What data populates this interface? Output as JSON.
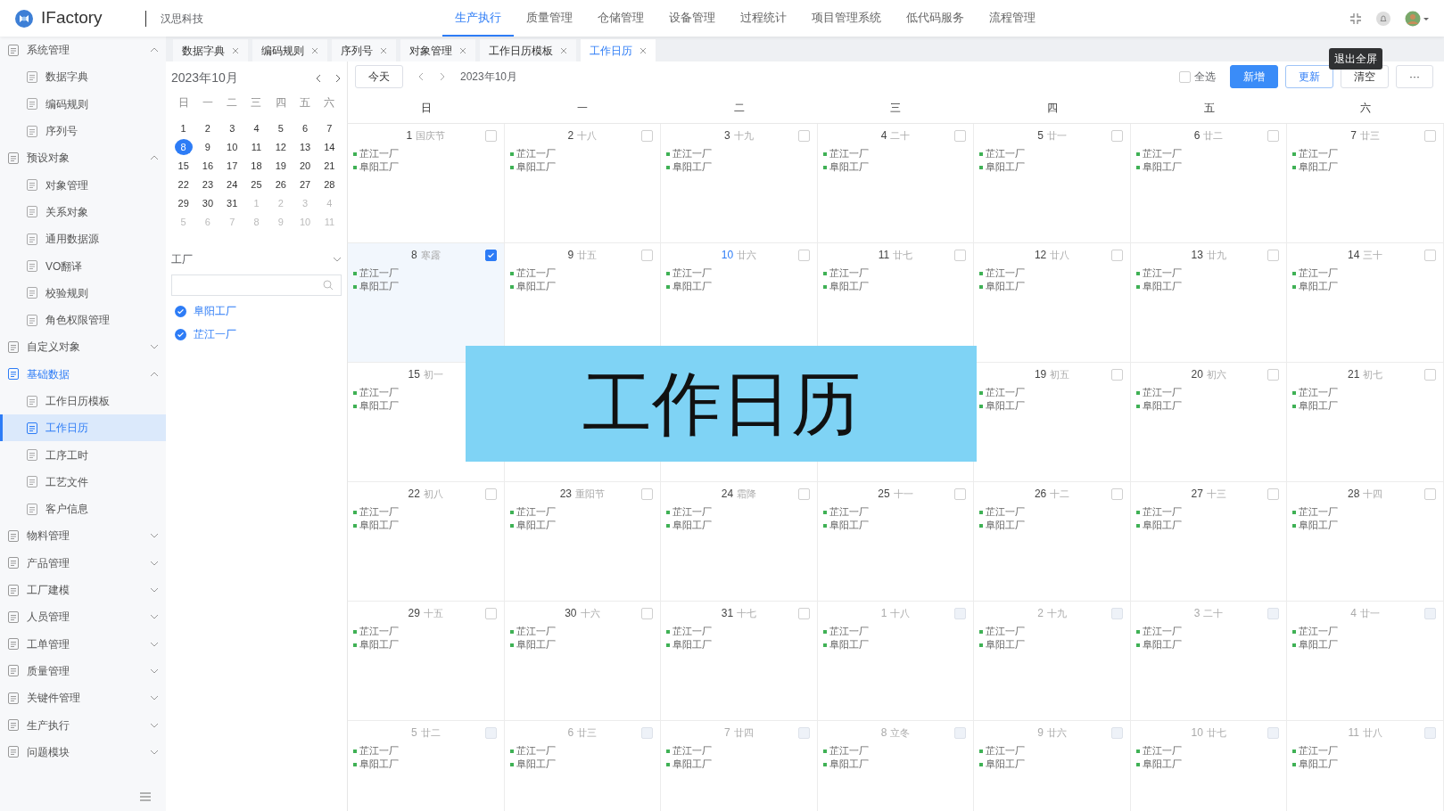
{
  "app": {
    "name": "IFactory",
    "company": "汉思科技"
  },
  "top_menu": [
    {
      "label": "生产执行",
      "selected": true
    },
    {
      "label": "质量管理",
      "selected": false
    },
    {
      "label": "仓储管理",
      "selected": false
    },
    {
      "label": "设备管理",
      "selected": false
    },
    {
      "label": "过程统计",
      "selected": false
    },
    {
      "label": "项目管理系统",
      "selected": false
    },
    {
      "label": "低代码服务",
      "selected": false
    },
    {
      "label": "流程管理",
      "selected": false
    }
  ],
  "tooltip": "退出全屏",
  "sidebar": [
    {
      "label": "系统管理",
      "selected": false,
      "expanded": true,
      "children": [
        {
          "label": "数据字典",
          "selected": false
        },
        {
          "label": "编码规则",
          "selected": false
        },
        {
          "label": "序列号",
          "selected": false
        }
      ]
    },
    {
      "label": "预设对象",
      "selected": false,
      "expanded": true,
      "children": [
        {
          "label": "对象管理",
          "selected": false
        },
        {
          "label": "关系对象",
          "selected": false
        },
        {
          "label": "通用数据源",
          "selected": false
        },
        {
          "label": "VO翻译",
          "selected": false
        },
        {
          "label": "校验规则",
          "selected": false
        },
        {
          "label": "角色权限管理",
          "selected": false
        }
      ]
    },
    {
      "label": "自定义对象",
      "selected": false,
      "expanded": false
    },
    {
      "label": "基础数据",
      "selected": true,
      "expanded": true,
      "children": [
        {
          "label": "工作日历模板",
          "selected": false
        },
        {
          "label": "工作日历",
          "selected": true
        },
        {
          "label": "工序工时",
          "selected": false
        },
        {
          "label": "工艺文件",
          "selected": false
        },
        {
          "label": "客户信息",
          "selected": false
        }
      ]
    },
    {
      "label": "物料管理",
      "selected": false,
      "expanded": false
    },
    {
      "label": "产品管理",
      "selected": false,
      "expanded": false
    },
    {
      "label": "工厂建模",
      "selected": false,
      "expanded": false
    },
    {
      "label": "人员管理",
      "selected": false,
      "expanded": false
    },
    {
      "label": "工单管理",
      "selected": false,
      "expanded": false
    },
    {
      "label": "质量管理",
      "selected": false,
      "expanded": false
    },
    {
      "label": "关键件管理",
      "selected": false,
      "expanded": false
    },
    {
      "label": "生产执行",
      "selected": false,
      "expanded": false
    },
    {
      "label": "问题模块",
      "selected": false,
      "expanded": false
    }
  ],
  "tabs": [
    {
      "label": "数据字典",
      "selected": false
    },
    {
      "label": "编码规则",
      "selected": false
    },
    {
      "label": "序列号",
      "selected": false
    },
    {
      "label": "对象管理",
      "selected": false
    },
    {
      "label": "工作日历模板",
      "selected": false
    },
    {
      "label": "工作日历",
      "selected": true
    }
  ],
  "mini_calendar": {
    "title": "2023年10月",
    "weekdays": [
      "日",
      "一",
      "二",
      "三",
      "四",
      "五",
      "六"
    ],
    "days": [
      {
        "day": "1",
        "other_month": false,
        "selected": false
      },
      {
        "day": "2",
        "other_month": false,
        "selected": false
      },
      {
        "day": "3",
        "other_month": false,
        "selected": false
      },
      {
        "day": "4",
        "other_month": false,
        "selected": false
      },
      {
        "day": "5",
        "other_month": false,
        "selected": false
      },
      {
        "day": "6",
        "other_month": false,
        "selected": false
      },
      {
        "day": "7",
        "other_month": false,
        "selected": false
      },
      {
        "day": "8",
        "other_month": false,
        "selected": true
      },
      {
        "day": "9",
        "other_month": false,
        "selected": false
      },
      {
        "day": "10",
        "other_month": false,
        "selected": false
      },
      {
        "day": "11",
        "other_month": false,
        "selected": false
      },
      {
        "day": "12",
        "other_month": false,
        "selected": false
      },
      {
        "day": "13",
        "other_month": false,
        "selected": false
      },
      {
        "day": "14",
        "other_month": false,
        "selected": false
      },
      {
        "day": "15",
        "other_month": false,
        "selected": false
      },
      {
        "day": "16",
        "other_month": false,
        "selected": false
      },
      {
        "day": "17",
        "other_month": false,
        "selected": false
      },
      {
        "day": "18",
        "other_month": false,
        "selected": false
      },
      {
        "day": "19",
        "other_month": false,
        "selected": false
      },
      {
        "day": "20",
        "other_month": false,
        "selected": false
      },
      {
        "day": "21",
        "other_month": false,
        "selected": false
      },
      {
        "day": "22",
        "other_month": false,
        "selected": false
      },
      {
        "day": "23",
        "other_month": false,
        "selected": false
      },
      {
        "day": "24",
        "other_month": false,
        "selected": false
      },
      {
        "day": "25",
        "other_month": false,
        "selected": false
      },
      {
        "day": "26",
        "other_month": false,
        "selected": false
      },
      {
        "day": "27",
        "other_month": false,
        "selected": false
      },
      {
        "day": "28",
        "other_month": false,
        "selected": false
      },
      {
        "day": "29",
        "other_month": false,
        "selected": false
      },
      {
        "day": "30",
        "other_month": false,
        "selected": false
      },
      {
        "day": "31",
        "other_month": false,
        "selected": false
      },
      {
        "day": "1",
        "other_month": true,
        "selected": false
      },
      {
        "day": "2",
        "other_month": true,
        "selected": false
      },
      {
        "day": "3",
        "other_month": true,
        "selected": false
      },
      {
        "day": "4",
        "other_month": true,
        "selected": false
      },
      {
        "day": "5",
        "other_month": true,
        "selected": false
      },
      {
        "day": "6",
        "other_month": true,
        "selected": false
      },
      {
        "day": "7",
        "other_month": true,
        "selected": false
      },
      {
        "day": "8",
        "other_month": true,
        "selected": false
      },
      {
        "day": "9",
        "other_month": true,
        "selected": false
      },
      {
        "day": "10",
        "other_month": true,
        "selected": false
      },
      {
        "day": "11",
        "other_month": true,
        "selected": false
      }
    ]
  },
  "factory_filter": {
    "label": "工厂",
    "items": [
      {
        "label": "阜阳工厂",
        "checked": true
      },
      {
        "label": "芷江一厂",
        "checked": true
      }
    ]
  },
  "calendar": {
    "today_button": "今天",
    "title": "2023年10月",
    "select_all": {
      "label": "全选",
      "checked": false
    },
    "buttons": [
      {
        "label": "新增",
        "kind": "primary"
      },
      {
        "label": "更新",
        "kind": "outline"
      },
      {
        "label": "清空",
        "kind": "plain"
      },
      {
        "label": "···",
        "kind": "plain"
      }
    ],
    "weekdays": [
      "日",
      "一",
      "二",
      "三",
      "四",
      "五",
      "六"
    ],
    "cells": [
      {
        "day": "1",
        "lunar": "国庆节",
        "checked": false,
        "other_month": false,
        "today": false,
        "events": [
          "芷江一厂",
          "阜阳工厂"
        ]
      },
      {
        "day": "2",
        "lunar": "十八",
        "checked": false,
        "other_month": false,
        "today": false,
        "events": [
          "芷江一厂",
          "阜阳工厂"
        ]
      },
      {
        "day": "3",
        "lunar": "十九",
        "checked": false,
        "other_month": false,
        "today": false,
        "events": [
          "芷江一厂",
          "阜阳工厂"
        ]
      },
      {
        "day": "4",
        "lunar": "二十",
        "checked": false,
        "other_month": false,
        "today": false,
        "events": [
          "芷江一厂",
          "阜阳工厂"
        ]
      },
      {
        "day": "5",
        "lunar": "廿一",
        "checked": false,
        "other_month": false,
        "today": false,
        "events": [
          "芷江一厂",
          "阜阳工厂"
        ]
      },
      {
        "day": "6",
        "lunar": "廿二",
        "checked": false,
        "other_month": false,
        "today": false,
        "events": [
          "芷江一厂",
          "阜阳工厂"
        ]
      },
      {
        "day": "7",
        "lunar": "廿三",
        "checked": false,
        "other_month": false,
        "today": false,
        "events": [
          "芷江一厂",
          "阜阳工厂"
        ]
      },
      {
        "day": "8",
        "lunar": "寒露",
        "checked": true,
        "other_month": false,
        "today": false,
        "events": [
          "芷江一厂",
          "阜阳工厂"
        ]
      },
      {
        "day": "9",
        "lunar": "廿五",
        "checked": false,
        "other_month": false,
        "today": false,
        "events": [
          "芷江一厂",
          "阜阳工厂"
        ]
      },
      {
        "day": "10",
        "lunar": "廿六",
        "checked": false,
        "other_month": false,
        "today": true,
        "events": [
          "芷江一厂",
          "阜阳工厂"
        ]
      },
      {
        "day": "11",
        "lunar": "廿七",
        "checked": false,
        "other_month": false,
        "today": false,
        "events": [
          "芷江一厂",
          "阜阳工厂"
        ]
      },
      {
        "day": "12",
        "lunar": "廿八",
        "checked": false,
        "other_month": false,
        "today": false,
        "events": [
          "芷江一厂",
          "阜阳工厂"
        ]
      },
      {
        "day": "13",
        "lunar": "廿九",
        "checked": false,
        "other_month": false,
        "today": false,
        "events": [
          "芷江一厂",
          "阜阳工厂"
        ]
      },
      {
        "day": "14",
        "lunar": "三十",
        "checked": false,
        "other_month": false,
        "today": false,
        "events": [
          "芷江一厂",
          "阜阳工厂"
        ]
      },
      {
        "day": "15",
        "lunar": "初一",
        "other_month": false,
        "today": false,
        "events": [
          "芷江一厂",
          "阜阳工厂"
        ]
      },
      {},
      {},
      {},
      {
        "day": "19",
        "lunar": "初五",
        "checked": false,
        "other_month": false,
        "today": false,
        "events": [
          "芷江一厂",
          "阜阳工厂"
        ]
      },
      {
        "day": "20",
        "lunar": "初六",
        "checked": false,
        "other_month": false,
        "today": false,
        "events": [
          "芷江一厂",
          "阜阳工厂"
        ]
      },
      {
        "day": "21",
        "lunar": "初七",
        "checked": false,
        "other_month": false,
        "today": false,
        "events": [
          "芷江一厂",
          "阜阳工厂"
        ]
      },
      {
        "day": "22",
        "lunar": "初八",
        "checked": false,
        "other_month": false,
        "today": false,
        "events": [
          "芷江一厂",
          "阜阳工厂"
        ]
      },
      {
        "day": "23",
        "lunar": "重阳节",
        "checked": false,
        "other_month": false,
        "today": false,
        "events": [
          "芷江一厂",
          "阜阳工厂"
        ]
      },
      {
        "day": "24",
        "lunar": "霜降",
        "checked": false,
        "other_month": false,
        "today": false,
        "events": [
          "芷江一厂",
          "阜阳工厂"
        ]
      },
      {
        "day": "25",
        "lunar": "十一",
        "checked": false,
        "other_month": false,
        "today": false,
        "events": [
          "芷江一厂",
          "阜阳工厂"
        ]
      },
      {
        "day": "26",
        "lunar": "十二",
        "checked": false,
        "other_month": false,
        "today": false,
        "events": [
          "芷江一厂",
          "阜阳工厂"
        ]
      },
      {
        "day": "27",
        "lunar": "十三",
        "checked": false,
        "other_month": false,
        "today": false,
        "events": [
          "芷江一厂",
          "阜阳工厂"
        ]
      },
      {
        "day": "28",
        "lunar": "十四",
        "checked": false,
        "other_month": false,
        "today": false,
        "events": [
          "芷江一厂",
          "阜阳工厂"
        ]
      },
      {
        "day": "29",
        "lunar": "十五",
        "checked": false,
        "other_month": false,
        "today": false,
        "events": [
          "芷江一厂",
          "阜阳工厂"
        ]
      },
      {
        "day": "30",
        "lunar": "十六",
        "checked": false,
        "other_month": false,
        "today": false,
        "events": [
          "芷江一厂",
          "阜阳工厂"
        ]
      },
      {
        "day": "31",
        "lunar": "十七",
        "checked": false,
        "other_month": false,
        "today": false,
        "events": [
          "芷江一厂",
          "阜阳工厂"
        ]
      },
      {
        "day": "1",
        "lunar": "十八",
        "checked": false,
        "other_month": true,
        "today": false,
        "events": [
          "芷江一厂",
          "阜阳工厂"
        ]
      },
      {
        "day": "2",
        "lunar": "十九",
        "checked": false,
        "other_month": true,
        "today": false,
        "events": [
          "芷江一厂",
          "阜阳工厂"
        ]
      },
      {
        "day": "3",
        "lunar": "二十",
        "checked": false,
        "other_month": true,
        "today": false,
        "events": [
          "芷江一厂",
          "阜阳工厂"
        ]
      },
      {
        "day": "4",
        "lunar": "廿一",
        "checked": false,
        "other_month": true,
        "today": false,
        "events": [
          "芷江一厂",
          "阜阳工厂"
        ]
      },
      {
        "day": "5",
        "lunar": "廿二",
        "checked": false,
        "other_month": true,
        "today": false,
        "events": [
          "芷江一厂",
          "阜阳工厂"
        ]
      },
      {
        "day": "6",
        "lunar": "廿三",
        "checked": false,
        "other_month": true,
        "today": false,
        "events": [
          "芷江一厂",
          "阜阳工厂"
        ]
      },
      {
        "day": "7",
        "lunar": "廿四",
        "checked": false,
        "other_month": true,
        "today": false,
        "events": [
          "芷江一厂",
          "阜阳工厂"
        ]
      },
      {
        "day": "8",
        "lunar": "立冬",
        "checked": false,
        "other_month": true,
        "today": false,
        "events": [
          "芷江一厂",
          "阜阳工厂"
        ]
      },
      {
        "day": "9",
        "lunar": "廿六",
        "checked": false,
        "other_month": true,
        "today": false,
        "events": [
          "芷江一厂",
          "阜阳工厂"
        ]
      },
      {
        "day": "10",
        "lunar": "廿七",
        "checked": false,
        "other_month": true,
        "today": false,
        "events": [
          "芷江一厂",
          "阜阳工厂"
        ]
      },
      {
        "day": "11",
        "lunar": "廿八",
        "checked": false,
        "other_month": true,
        "today": false,
        "events": [
          "芷江一厂",
          "阜阳工厂"
        ]
      }
    ]
  },
  "overlay_caption": "工作日历"
}
